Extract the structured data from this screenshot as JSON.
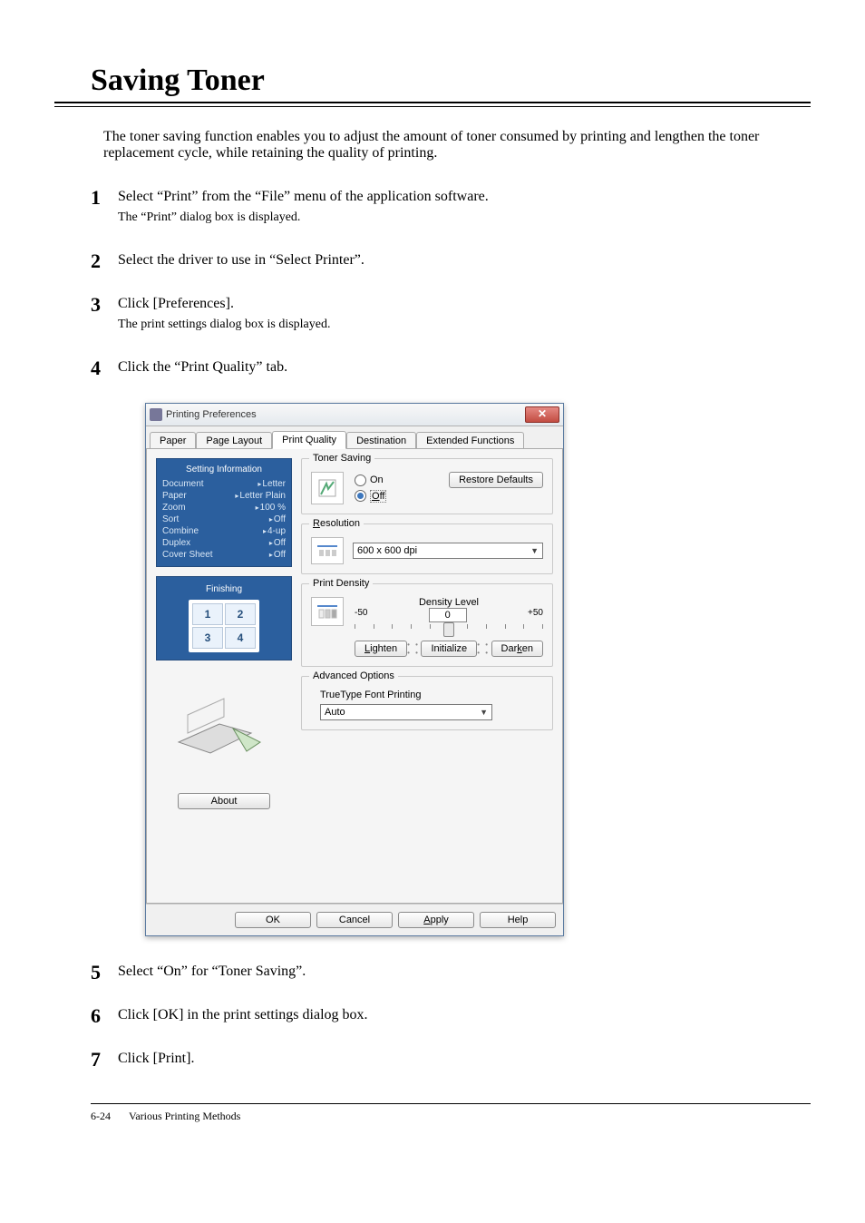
{
  "section_title": "Saving Toner",
  "intro": "The toner saving function enables you to adjust the amount of toner consumed by printing and lengthen the toner replacement cycle, while retaining the quality of printing.",
  "steps": [
    {
      "n": "1",
      "main": "Select “Print” from the “File” menu of the application software.",
      "sub": "The “Print” dialog box is displayed."
    },
    {
      "n": "2",
      "main": "Select the driver to use in “Select Printer”.",
      "sub": ""
    },
    {
      "n": "3",
      "main": "Click [Preferences].",
      "sub": "The print settings dialog box is displayed."
    },
    {
      "n": "4",
      "main": "Click the “Print Quality” tab.",
      "sub": ""
    },
    {
      "n": "5",
      "main": "Select “On” for “Toner Saving”.",
      "sub": ""
    },
    {
      "n": "6",
      "main": "Click [OK] in the print settings dialog box.",
      "sub": ""
    },
    {
      "n": "7",
      "main": "Click [Print].",
      "sub": ""
    }
  ],
  "dialog": {
    "title": "Printing Preferences",
    "tabs": [
      "Paper",
      "Page Layout",
      "Print Quality",
      "Destination",
      "Extended Functions"
    ],
    "active_tab": "Print Quality",
    "setting_info_header": "Setting Information",
    "setting_info": [
      {
        "k": "Document",
        "v": "Letter"
      },
      {
        "k": "Paper",
        "v": "Letter Plain"
      },
      {
        "k": "Zoom",
        "v": "100 %"
      },
      {
        "k": "Sort",
        "v": "Off"
      },
      {
        "k": "Combine",
        "v": "4-up"
      },
      {
        "k": "Duplex",
        "v": "Off"
      },
      {
        "k": "Cover Sheet",
        "v": "Off"
      }
    ],
    "finishing_label": "Finishing",
    "finishing_cells": [
      "1",
      "2",
      "3",
      "4"
    ],
    "about_label": "About",
    "restore_label": "Restore Defaults",
    "toner_saving": {
      "legend": "Toner Saving",
      "on": "On",
      "off": "Off"
    },
    "resolution": {
      "legend": "Resolution",
      "value": "600 x 600 dpi"
    },
    "print_density": {
      "legend": "Print Density",
      "density_level_label": "Density Level",
      "min": "-50",
      "max": "+50",
      "value": "0",
      "lighten": "Lighten",
      "initialize": "Initialize",
      "darken": "Darken"
    },
    "advanced": {
      "legend": "Advanced Options",
      "tt_label": "TrueType Font Printing",
      "tt_value": "Auto"
    },
    "footer": {
      "ok": "OK",
      "cancel": "Cancel",
      "apply": "Apply",
      "help": "Help"
    }
  },
  "footer": {
    "page": "6-24",
    "running": "Various Printing Methods"
  }
}
